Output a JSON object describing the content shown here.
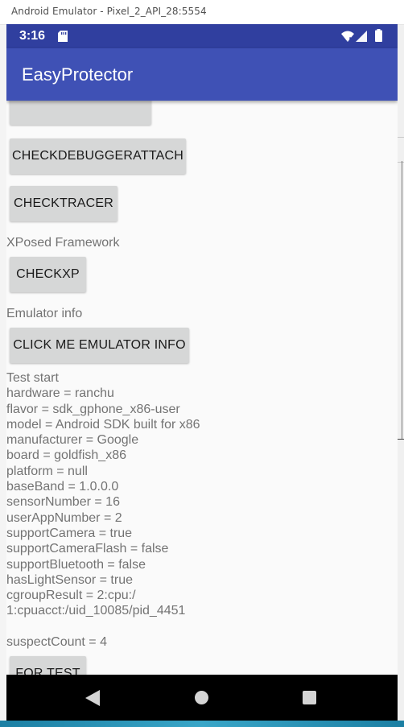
{
  "window": {
    "title": "Android Emulator - Pixel_2_API_28:5554"
  },
  "statusbar": {
    "time": "3:16",
    "icons": [
      "sd-card-icon",
      "wifi-icon",
      "signal-icon",
      "battery-icon"
    ]
  },
  "appbar": {
    "title": "EasyProtector"
  },
  "content": {
    "buttons": {
      "check_debugger_attach": "CHECKDEBUGGERATTACH",
      "check_tracer": "CHECKTRACER",
      "check_xp": "CHECKXP",
      "emulator_info": "CLICK ME EMULATOR INFO",
      "for_test": "FOR TEST"
    },
    "labels": {
      "xposed": "XPosed Framework",
      "emulator": "Emulator info"
    },
    "emulator_info_lines": [
      "Test start",
      "hardware = ranchu",
      "flavor = sdk_gphone_x86-user",
      "model = Android SDK built for x86",
      "manufacturer = Google",
      "board = goldfish_x86",
      "platform = null",
      "baseBand = 1.0.0.0",
      "sensorNumber = 16",
      "userAppNumber = 2",
      "supportCamera = true",
      "supportCameraFlash = false",
      "supportBluetooth = false",
      "hasLightSensor = true",
      "cgroupResult = 2:cpu:/",
      "1:cpuacct:/uid_10085/pid_4451",
      "",
      "suspectCount = 4"
    ]
  },
  "navbar": {
    "icons": [
      "back-icon",
      "home-icon",
      "recent-apps-icon"
    ]
  },
  "colors": {
    "primary": "#3f51b5",
    "primary_dark": "#303f9f",
    "button_bg": "#d6d7d7",
    "text_secondary": "#737373",
    "screen_bg": "#fafafa",
    "navbar_bg": "#000000"
  }
}
